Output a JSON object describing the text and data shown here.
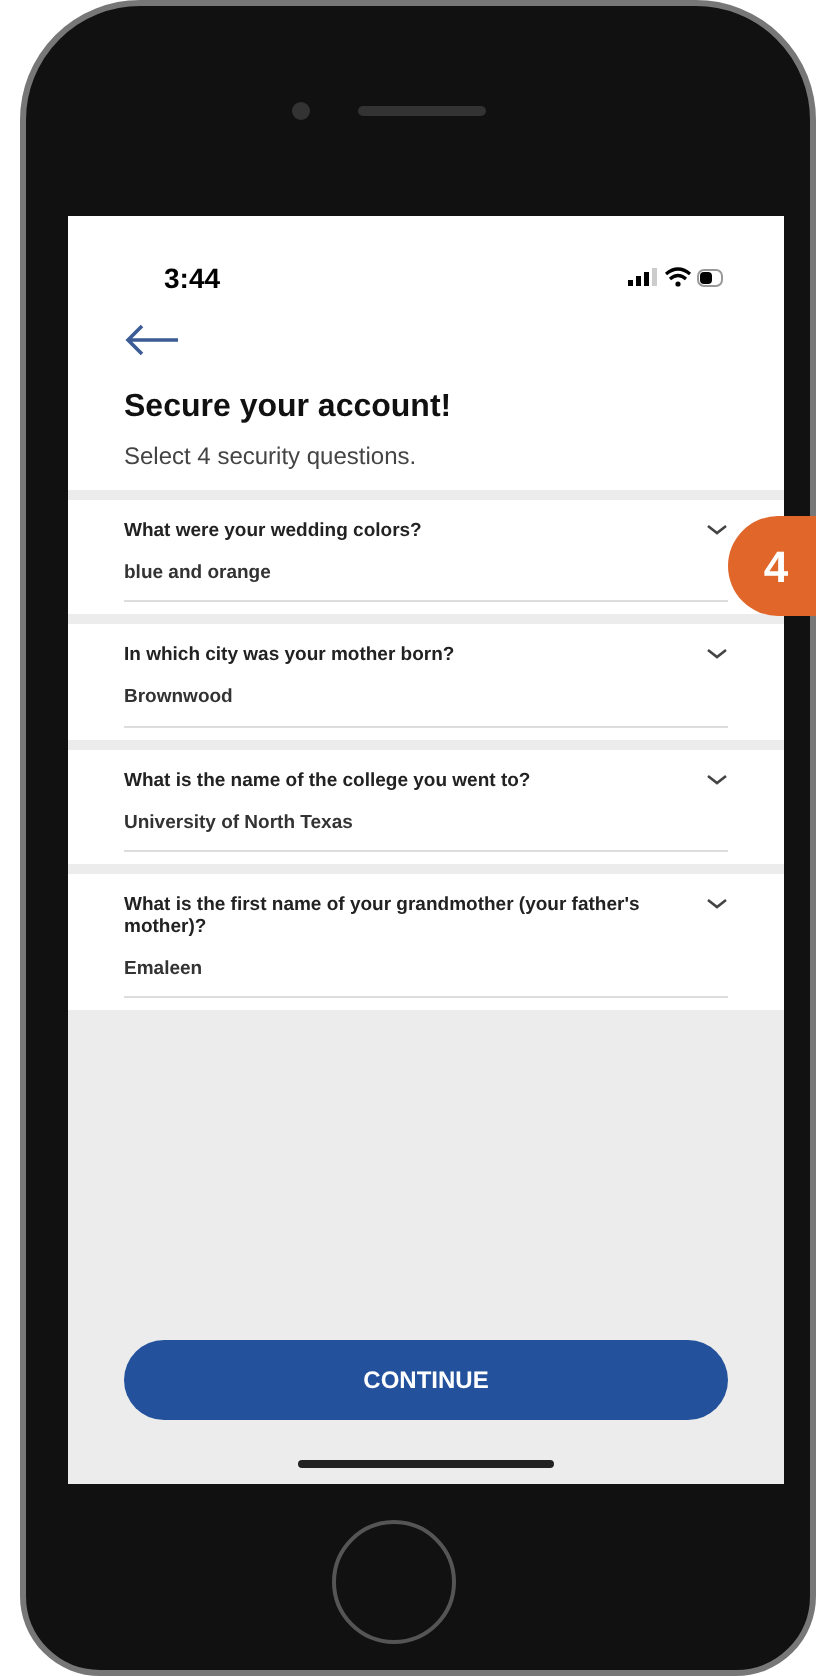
{
  "status_bar": {
    "time": "3:44"
  },
  "header": {
    "title": "Secure your account!",
    "subtitle": "Select 4 security questions."
  },
  "questions": [
    {
      "question": "What were your wedding colors?",
      "answer": "blue and orange"
    },
    {
      "question": "In which city was your mother born?",
      "answer": "Brownwood"
    },
    {
      "question": "What is the name of the college you went to?",
      "answer": "University of North Texas"
    },
    {
      "question": "What is the first name of your grandmother (your father's mother)?",
      "answer": "Emaleen"
    }
  ],
  "continue_button": {
    "label": "CONTINUE"
  },
  "step_badge": "4"
}
